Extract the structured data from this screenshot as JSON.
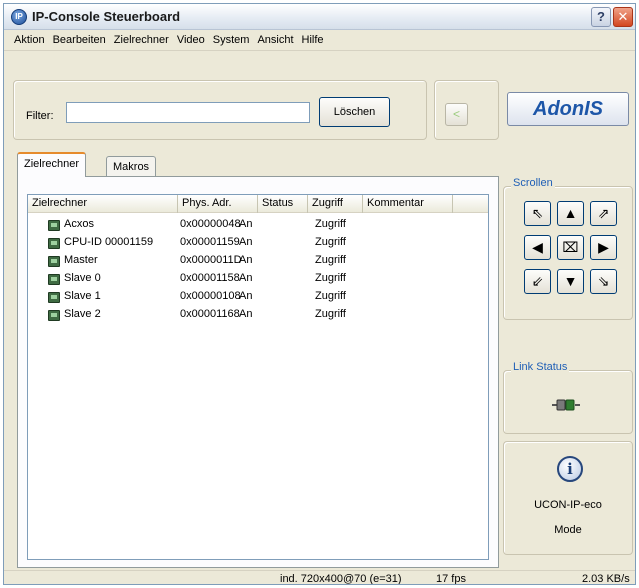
{
  "window": {
    "title": "IP-Console Steuerboard",
    "app_icon": "IP",
    "help_label": "?",
    "close_label": "✕"
  },
  "menu": [
    "Aktion",
    "Bearbeiten",
    "Zielrechner",
    "Video",
    "System",
    "Ansicht",
    "Hilfe"
  ],
  "filter": {
    "label": "Filter:",
    "value": "",
    "clear_label": "Löschen",
    "back_label": "<"
  },
  "logo": "AdonIS",
  "tabs": [
    "Zielrechner",
    "Makros"
  ],
  "table": {
    "columns": [
      "Zielrechner",
      "Phys. Adr.",
      "Status",
      "Zugriff",
      "Kommentar"
    ],
    "rows": [
      {
        "name": "Acxos",
        "addr": "0x00000048",
        "status": "An",
        "access": "Zugriff"
      },
      {
        "name": "CPU-ID 00001159",
        "addr": "0x00001159",
        "status": "An",
        "access": "Zugriff"
      },
      {
        "name": "Master",
        "addr": "0x0000011D",
        "status": "An",
        "access": "Zugriff"
      },
      {
        "name": "Slave 0",
        "addr": "0x00001158",
        "status": "An",
        "access": "Zugriff"
      },
      {
        "name": "Slave 1",
        "addr": "0x00000108",
        "status": "An",
        "access": "Zugriff"
      },
      {
        "name": "Slave 2",
        "addr": "0x00001168",
        "status": "An",
        "access": "Zugriff"
      }
    ]
  },
  "scroll": {
    "title": "Scrollen",
    "buttons": [
      {
        "glyph": "⇖",
        "name": "scroll-up-left-button"
      },
      {
        "glyph": "▲",
        "name": "scroll-up-button"
      },
      {
        "glyph": "⇗",
        "name": "scroll-up-right-button"
      },
      {
        "glyph": "◀",
        "name": "scroll-left-button"
      },
      {
        "glyph": "⌧",
        "name": "scroll-center-button"
      },
      {
        "glyph": "▶",
        "name": "scroll-right-button"
      },
      {
        "glyph": "⇙",
        "name": "scroll-down-left-button"
      },
      {
        "glyph": "▼",
        "name": "scroll-down-button"
      },
      {
        "glyph": "⇘",
        "name": "scroll-down-right-button"
      }
    ]
  },
  "link_status": {
    "title": "Link Status",
    "icon": "connector-icon"
  },
  "device": {
    "icon": "i",
    "name": "UCON-IP-eco",
    "mode": "Mode"
  },
  "status": {
    "video": "ind. 720x400@70 (e=31)",
    "fps": "17 fps",
    "rate": "2.03 KB/s"
  },
  "colors": {
    "accent_blue": "#1f5fb6",
    "tab_highlight": "#e68b2c",
    "row_icon": "#3f6b43"
  }
}
